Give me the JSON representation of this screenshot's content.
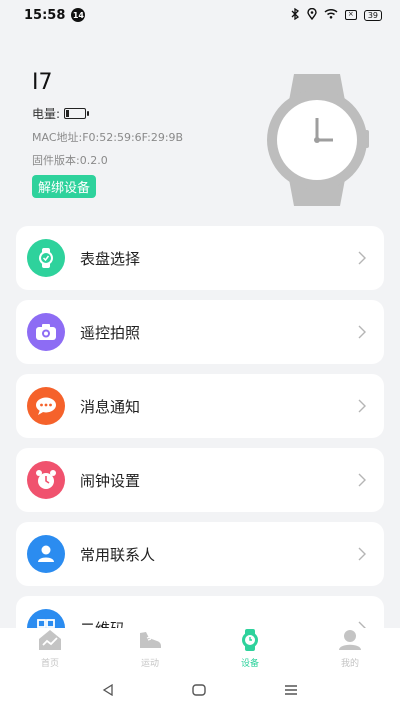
{
  "status_bar": {
    "time": "15:58",
    "notification_count": "14",
    "battery_level": "39"
  },
  "device": {
    "name": "I7",
    "battery_label": "电量:",
    "mac_line": "MAC地址:F0:52:59:6F:29:9B",
    "firmware_line": "固件版本:0.2.0",
    "unbind_label": "解绑设备"
  },
  "menu": {
    "items": [
      {
        "label": "表盘选择",
        "icon": "watch-face-icon",
        "color": "#2ed29c"
      },
      {
        "label": "遥控拍照",
        "icon": "camera-icon",
        "color": "#8d6cf4"
      },
      {
        "label": "消息通知",
        "icon": "message-icon",
        "color": "#f5622b"
      },
      {
        "label": "闹钟设置",
        "icon": "alarm-clock-icon",
        "color": "#f0526e"
      },
      {
        "label": "常用联系人",
        "icon": "contact-icon",
        "color": "#2b8cf0"
      },
      {
        "label": "二维码",
        "icon": "qr-code-icon",
        "color": "#2b8cf0"
      }
    ]
  },
  "bottom_nav": {
    "items": [
      {
        "label": "首页",
        "icon": "home-chart-icon"
      },
      {
        "label": "运动",
        "icon": "shoe-icon"
      },
      {
        "label": "设备",
        "icon": "watch-icon",
        "active": true
      },
      {
        "label": "我的",
        "icon": "person-icon"
      }
    ],
    "active_color": "#2ed29c"
  },
  "system_nav": {
    "buttons": [
      "back-icon",
      "home-icon",
      "recents-icon"
    ]
  }
}
